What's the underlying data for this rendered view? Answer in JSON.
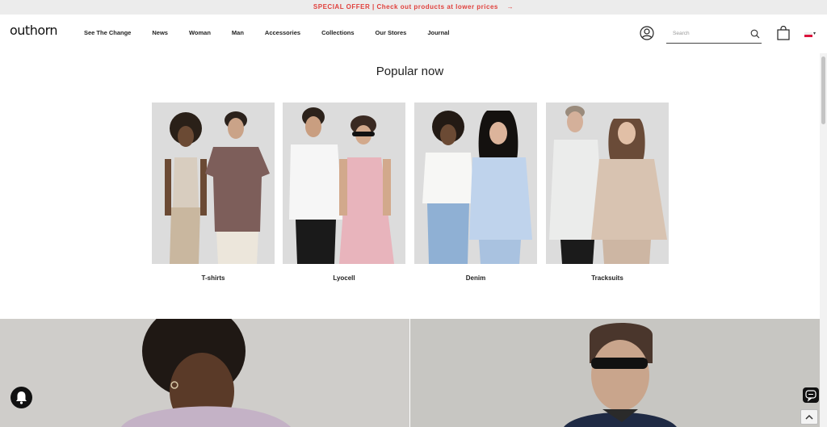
{
  "promo": {
    "offer_label": "SPECIAL OFFER",
    "separator": "|",
    "offer_text": "Check out products at lower prices",
    "arrow": "→"
  },
  "header": {
    "logo": "outhorn",
    "nav": [
      "See The Change",
      "News",
      "Woman",
      "Man",
      "Accessories",
      "Collections",
      "Our Stores",
      "Journal"
    ],
    "search_placeholder": "Search",
    "icons": [
      "user-icon",
      "search-icon",
      "shopping-bag-icon",
      "flag-icon"
    ]
  },
  "main": {
    "section_title": "Popular now",
    "categories": [
      {
        "label": "T-shirts"
      },
      {
        "label": "Lyocell"
      },
      {
        "label": "Denim"
      },
      {
        "label": "Tracksuits"
      }
    ]
  },
  "floating": {
    "icons": [
      "bell-icon",
      "chat-icon",
      "scroll-top-icon"
    ]
  },
  "colors": {
    "promo_text": "#e0403c",
    "promo_bg": "#ececec",
    "image_bg": "#dcdcdc",
    "text": "#222222"
  }
}
